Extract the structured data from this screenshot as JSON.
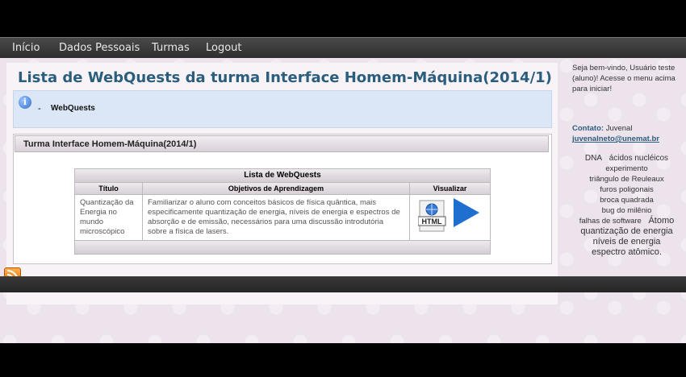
{
  "nav": {
    "items": [
      "Início",
      "Dados Pessoais",
      "Turmas",
      "Logout"
    ]
  },
  "main": {
    "title": "Lista de WebQuests da turma Interface Homem-Máquina(2014/1)",
    "info": {
      "dash": "-",
      "text": "WebQuests"
    },
    "panel_title": "Turma Interface Homem-Máquina(2014/1)",
    "table": {
      "caption": "Lista de WebQuests",
      "headers": [
        "Título",
        "Objetivos de Aprendizagem",
        "Visualizar"
      ],
      "rows": [
        {
          "titulo": "Quantização da Energia no mundo microscópico",
          "objetivos": "Familiarizar o aluno com conceitos básicos de física quântica, mais especificamente quantização de energia, níveis de energia e espectros de absorção e de emissão, necessários para uma discussão introdutória sobre a física de lasers.",
          "html_icon_label": "HTML"
        }
      ]
    }
  },
  "sidebar": {
    "welcome": "Seja bem-vindo, Usuário teste (aluno)! Acesse o menu acima para iniciar!",
    "contact_label": "Contato:",
    "contact_name": "Juvenal",
    "contact_email": "juvenalneto@unemat.br",
    "tags": [
      {
        "text": "DNA",
        "size": 10
      },
      {
        "text": "ácidos nucléicos",
        "size": 10
      },
      {
        "text": "experimento",
        "size": 9.5
      },
      {
        "text": "triângulo de Reuleaux",
        "size": 9.5
      },
      {
        "text": "furos poligonais",
        "size": 9.5
      },
      {
        "text": "broca quadrada",
        "size": 9.5
      },
      {
        "text": "bug do milênio",
        "size": 9.5
      },
      {
        "text": "falhas de software",
        "size": 9.5
      },
      {
        "text": "Átomo",
        "size": 11
      },
      {
        "text": "quantização de energia",
        "size": 11
      },
      {
        "text": "níveis de energia",
        "size": 11
      },
      {
        "text": "espectro atômico.",
        "size": 11
      }
    ]
  },
  "colors": {
    "title": "#2b5d7d",
    "navbar": "#3a3a3a",
    "info_bg": "#dbe6f7",
    "play": "#1f6fd0",
    "rss": "#e4680c"
  },
  "icons": {
    "info": "info-icon",
    "html": "html-file-icon",
    "play": "play-icon",
    "rss": "rss-icon"
  }
}
